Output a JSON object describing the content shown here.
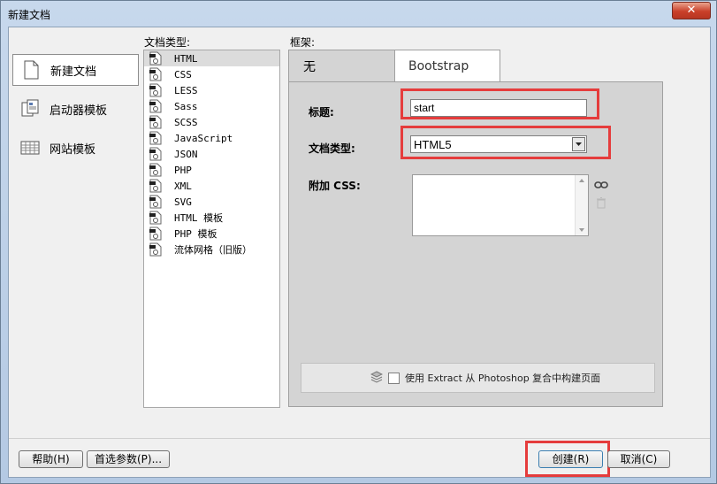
{
  "window": {
    "title": "新建文档",
    "close_glyph": "✕"
  },
  "left_nav": {
    "items": [
      {
        "label": "新建文档",
        "icon": "blank-document-icon",
        "active": true
      },
      {
        "label": "启动器模板",
        "icon": "starter-template-icon",
        "active": false
      },
      {
        "label": "网站模板",
        "icon": "site-template-icon",
        "active": false
      }
    ]
  },
  "doc_types": {
    "label": "文档类型:",
    "selected": "HTML",
    "items": [
      "HTML",
      "CSS",
      "LESS",
      "Sass",
      "SCSS",
      "JavaScript",
      "JSON",
      "PHP",
      "XML",
      "SVG",
      "HTML 模板",
      "PHP 模板",
      "流体网格（旧版）"
    ]
  },
  "frame": {
    "label": "框架:",
    "tabs": [
      {
        "label": "无",
        "active": true
      },
      {
        "label": "Bootstrap",
        "active": false
      }
    ],
    "title_label": "标题:",
    "title_value": "start",
    "doctype_label": "文档类型:",
    "doctype_value": "HTML5",
    "css_label": "附加 CSS:",
    "extract_text": "使用 Extract 从 Photoshop 复合中构建页面"
  },
  "buttons": {
    "help": "帮助(H)",
    "prefs": "首选参数(P)...",
    "create": "创建(R)",
    "cancel": "取消(C)"
  },
  "colors": {
    "highlight_box": "#e53c3c",
    "dialog_bg": "#f0f0f0",
    "panel_bg": "#d4d4d4"
  }
}
